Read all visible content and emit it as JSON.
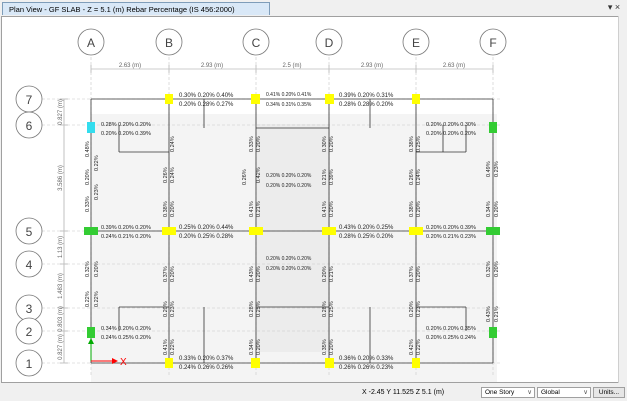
{
  "window": {
    "tab_title": "Plan View - GF SLAB - Z = 5.1 (m)  Rebar Percentage  (IS 456:2000)",
    "pin_glyph": "▾ ×"
  },
  "grid": {
    "columns": [
      "A",
      "B",
      "C",
      "D",
      "E",
      "F"
    ],
    "rows": [
      "7",
      "6",
      "5",
      "4",
      "3",
      "2",
      "1"
    ],
    "spacings_x": [
      "2.63 (m)",
      "2.93 (m)",
      "2.5 (m)",
      "2.93 (m)",
      "2.63 (m)"
    ],
    "spacings_y": [
      "0.827 (m)",
      "3.586 (m)",
      "1.13 (m)",
      "1.483 (m)",
      "0.803 (m)",
      "0.827 (m)"
    ]
  },
  "axis_label_x": "X",
  "labels": {
    "r7_b": "0.30% 0.20% 0.40%",
    "r7_b2": "0.20% 0.28% 0.27%",
    "r7_c": "0.41% 0.20% 0.41%",
    "r7_c2": "0.34% 0.31% 0.35%",
    "r7_d": "0.39% 0.20% 0.31%",
    "r7_d2": "0.28% 0.28% 0.20%",
    "r6_a": "0.28% 0.20% 0.20%",
    "r6_a2": "0.20% 0.20% 0.39%",
    "r6_e": "0.20% 0.20% 0.30%",
    "r6_e2": "0.20% 0.20% 0.20%",
    "mid_c": "0.20% 0.20% 0.20%",
    "mid_c2": "0.20% 0.20% 0.20%",
    "r5_a": "0.39% 0.20% 0.20%",
    "r5_a2": "0.24% 0.21% 0.20%",
    "r5_b": "0.25% 0.20% 0.44%",
    "r5_b2": "0.20% 0.25% 0.28%",
    "r5_d": "0.43% 0.20% 0.25%",
    "r5_d2": "0.28% 0.25% 0.20%",
    "r5_e": "0.20% 0.20% 0.39%",
    "r5_e2": "0.20% 0.21% 0.23%",
    "r4_c": "0.20% 0.20% 0.20%",
    "r4_c2": "0.20% 0.20% 0.20%",
    "r2_a": "0.34% 0.20% 0.20%",
    "r2_a2": "0.24% 0.25% 0.20%",
    "r2_e": "0.20% 0.20% 0.35%",
    "r2_e2": "0.20% 0.25% 0.24%",
    "r1_b": "0.33% 0.20% 0.37%",
    "r1_b2": "0.24% 0.26% 0.26%",
    "r1_d": "0.36% 0.20% 0.33%",
    "r1_d2": "0.26% 0.26% 0.23%",
    "v1": "0.48%",
    "v2": "0.22%",
    "v3": "0.24%",
    "v4": "0.33%",
    "v5": "0.20%",
    "v6": "0.30%",
    "v7": "0.38%",
    "v8": "0.49%",
    "v9": "0.23%",
    "v10": "0.25%",
    "v11": "0.29%",
    "v12": "0.26%",
    "v13": "0.42%",
    "v14": "0.21%",
    "v15": "0.41%",
    "v16": "0.39%",
    "v17": "0.34%",
    "v18": "0.32%",
    "v19": "0.37%",
    "v20": "0.43%",
    "v21": "0.35%",
    "v22": "0.28%"
  },
  "status": {
    "coords": "X -2.45  Y 11.525  Z 5.1 (m)",
    "story_select": "One Story",
    "coord_select": "Global",
    "units_button": "Units..."
  },
  "colors": {
    "support_yellow": "#ffff00",
    "support_green": "#33cc33",
    "support_cyan": "#33ddee",
    "axis_red": "#ff0000",
    "axis_green": "#00aa00"
  }
}
